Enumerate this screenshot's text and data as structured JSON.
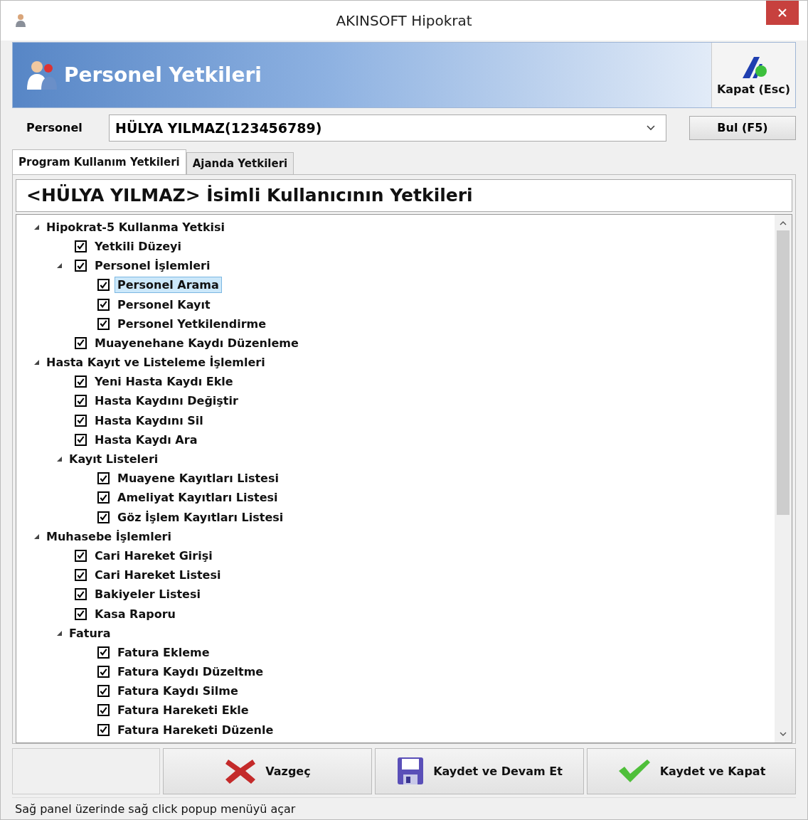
{
  "window": {
    "title": "AKINSOFT Hipokrat"
  },
  "header": {
    "title": "Personel Yetkileri",
    "close_label": "Kapat (Esc)"
  },
  "personel": {
    "label": "Personel",
    "value": "HÜLYA YILMAZ(123456789)",
    "find_button": "Bul (F5)"
  },
  "tabs": [
    {
      "label": "Program Kullanım Yetkileri",
      "selected": true
    },
    {
      "label": "Ajanda Yetkileri",
      "selected": false
    }
  ],
  "heading": "<HÜLYA YILMAZ> İsimli Kullanıcının Yetkileri",
  "tree": [
    {
      "label": "Hipokrat-5  Kullanma Yetkisi",
      "kind": "group",
      "expanded": true,
      "selected": false,
      "children": [
        {
          "label": "Yetkili Düzeyi",
          "kind": "check",
          "checked": true,
          "selected": false
        },
        {
          "label": "Personel İşlemleri",
          "kind": "check",
          "checked": true,
          "expanded": true,
          "selected": false,
          "children": [
            {
              "label": "Personel Arama",
              "kind": "check",
              "checked": true,
              "selected": true
            },
            {
              "label": "Personel Kayıt",
              "kind": "check",
              "checked": true,
              "selected": false
            },
            {
              "label": "Personel Yetkilendirme",
              "kind": "check",
              "checked": true,
              "selected": false
            }
          ]
        },
        {
          "label": "Muayenehane Kaydı Düzenleme",
          "kind": "check",
          "checked": true,
          "selected": false
        }
      ]
    },
    {
      "label": "Hasta Kayıt ve Listeleme İşlemleri",
      "kind": "group",
      "expanded": true,
      "selected": false,
      "children": [
        {
          "label": "Yeni Hasta Kaydı Ekle",
          "kind": "check",
          "checked": true,
          "selected": false
        },
        {
          "label": "Hasta Kaydını Değiştir",
          "kind": "check",
          "checked": true,
          "selected": false
        },
        {
          "label": "Hasta Kaydını Sil",
          "kind": "check",
          "checked": true,
          "selected": false
        },
        {
          "label": "Hasta Kaydı Ara",
          "kind": "check",
          "checked": true,
          "selected": false
        },
        {
          "label": "Kayıt Listeleri",
          "kind": "group",
          "expanded": true,
          "selected": false,
          "children": [
            {
              "label": "Muayene Kayıtları Listesi",
              "kind": "check",
              "checked": true,
              "selected": false
            },
            {
              "label": "Ameliyat Kayıtları Listesi",
              "kind": "check",
              "checked": true,
              "selected": false
            },
            {
              "label": "Göz İşlem Kayıtları Listesi",
              "kind": "check",
              "checked": true,
              "selected": false
            }
          ]
        }
      ]
    },
    {
      "label": "Muhasebe İşlemleri",
      "kind": "group",
      "expanded": true,
      "selected": false,
      "children": [
        {
          "label": "Cari Hareket Girişi",
          "kind": "check",
          "checked": true,
          "selected": false
        },
        {
          "label": "Cari Hareket Listesi",
          "kind": "check",
          "checked": true,
          "selected": false
        },
        {
          "label": "Bakiyeler Listesi",
          "kind": "check",
          "checked": true,
          "selected": false
        },
        {
          "label": "Kasa Raporu",
          "kind": "check",
          "checked": true,
          "selected": false
        },
        {
          "label": "Fatura",
          "kind": "group",
          "expanded": true,
          "selected": false,
          "children": [
            {
              "label": "Fatura Ekleme",
              "kind": "check",
              "checked": true,
              "selected": false
            },
            {
              "label": "Fatura Kaydı Düzeltme",
              "kind": "check",
              "checked": true,
              "selected": false
            },
            {
              "label": "Fatura Kaydı Silme",
              "kind": "check",
              "checked": true,
              "selected": false
            },
            {
              "label": "Fatura Hareketi Ekle",
              "kind": "check",
              "checked": true,
              "selected": false
            },
            {
              "label": "Fatura Hareketi Düzenle",
              "kind": "check",
              "checked": true,
              "selected": false
            }
          ]
        }
      ]
    }
  ],
  "buttons": [
    {
      "label": "Vazgeç",
      "kind": "cancel"
    },
    {
      "label": "Kaydet ve Devam Et",
      "kind": "save"
    },
    {
      "label": "Kaydet ve Kapat",
      "kind": "ok"
    }
  ],
  "status_bar": "Sağ panel üzerinde sağ click popup menüyü açar"
}
